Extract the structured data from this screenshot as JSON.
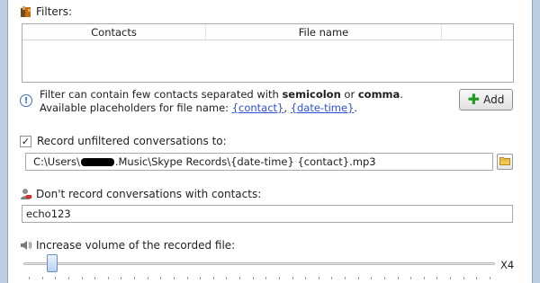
{
  "filters": {
    "label": "Filters:",
    "columns": [
      "Contacts",
      "File name"
    ]
  },
  "info": {
    "line1_prefix": "Filter can contain few contacts separated with ",
    "bold1": "semicolon",
    "line1_mid": " or ",
    "bold2": "comma",
    "line1_suffix": ".",
    "line2_prefix": "Available placeholders for file name: ",
    "link1": "{contact}",
    "link_sep": ", ",
    "link2": "{date-time}",
    "line2_suffix": "."
  },
  "add_button": {
    "label": "Add"
  },
  "record_unfiltered": {
    "checked": true,
    "check_glyph": "✓",
    "label": "Record unfiltered conversations to:",
    "path_before": "C:\\Users\\",
    "path_after": ".Music\\Skype Records\\{date-time} {contact}.mp3"
  },
  "dont_record": {
    "label": "Don't record conversations with contacts:",
    "value": "echo123"
  },
  "volume": {
    "label": "Increase volume of the recorded file:",
    "max_label": "X4",
    "slider_fraction": 0.05
  },
  "colors": {
    "link": "#2b4fd8",
    "add_plus": "#1f9a1f",
    "window_edge": "#bccfe4"
  },
  "icons": {
    "filters": "filter-book-icon",
    "info": "info-icon",
    "add": "plus-icon",
    "folder": "folder-icon",
    "dont_record": "no-record-user-icon",
    "volume": "speaker-icon"
  }
}
